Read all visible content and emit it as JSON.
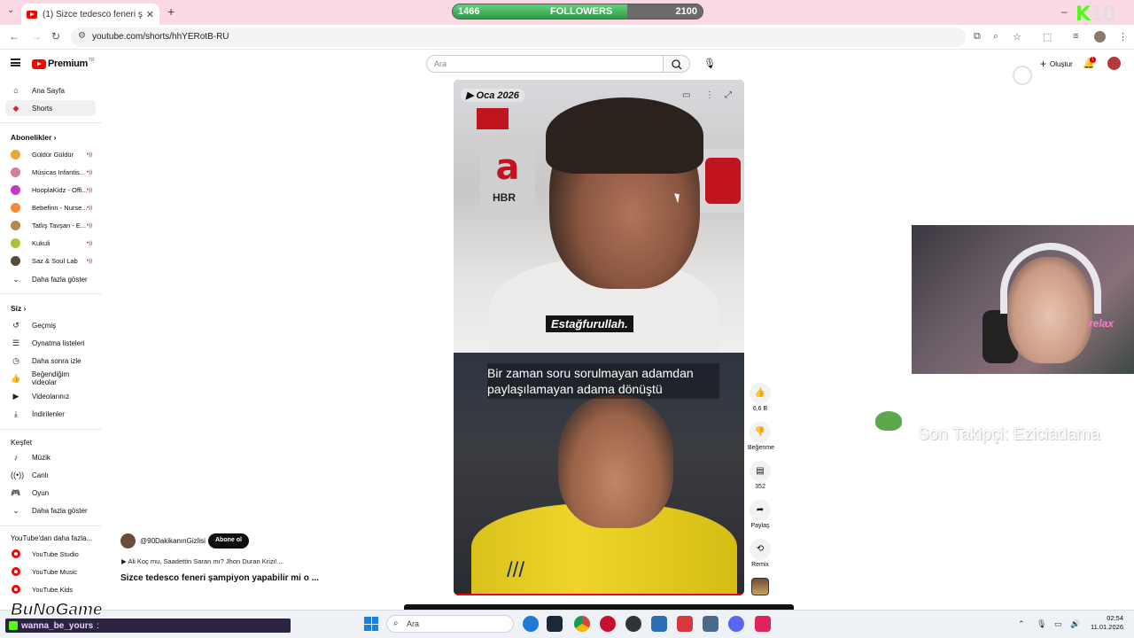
{
  "browser": {
    "tab_title": "(1) Sizce tedesco feneri şampiyon",
    "url": "youtube.com/shorts/hhYERotB-RU"
  },
  "overlay": {
    "followers_current": "1466",
    "followers_label": "FOLLOWERS",
    "followers_goal": "2100",
    "followers_progress": 0.6981,
    "kick_num": "10",
    "last_follower": "Son Takipçi: Eziciadama",
    "bunogame": "BuNoGame",
    "chat_user": "wanna_be_yours",
    "chat_sep": ":"
  },
  "header": {
    "logo": "Premium",
    "logo_cc": "TR",
    "search_placeholder": "Ara",
    "create_label": "Oluştur",
    "bell_badge": "1"
  },
  "sidebar": {
    "main": [
      {
        "label": "Ana Sayfa",
        "icon": "home-icon"
      },
      {
        "label": "Shorts",
        "icon": "shorts-icon"
      }
    ],
    "subs_title": "Abonelikler",
    "subs": [
      {
        "label": "Güldür Güldür",
        "color": "#e8a83a"
      },
      {
        "label": "Músicas Infantis...",
        "color": "#d77b9c"
      },
      {
        "label": "HooplaKidz - Offi...",
        "color": "#c23ac4"
      },
      {
        "label": "Bebefinn - Nurse...",
        "color": "#f28a3a"
      },
      {
        "label": "Tatlış Tavşan - E...",
        "color": "#b5894c"
      },
      {
        "label": "Kukuli",
        "color": "#a8c43a"
      },
      {
        "label": "Saz & Soul Lab",
        "color": "#5a4a3a"
      }
    ],
    "show_more": "Daha fazla göster",
    "you_title": "Siz",
    "you": [
      {
        "label": "Geçmiş"
      },
      {
        "label": "Oynatma listeleri"
      },
      {
        "label": "Daha sonra izle"
      },
      {
        "label": "Beğendiğim videolar"
      },
      {
        "label": "Videolarınız"
      },
      {
        "label": "İndirilenler"
      }
    ],
    "explore_title": "Keşfet",
    "explore": [
      {
        "label": "Müzik"
      },
      {
        "label": "Canlı"
      },
      {
        "label": "Oyun"
      }
    ],
    "show_more_2": "Daha fazla göster",
    "more_title": "YouTube'dan daha fazla...",
    "more": [
      {
        "label": "YouTube Studio"
      },
      {
        "label": "YouTube Music"
      },
      {
        "label": "YouTube Kids"
      }
    ]
  },
  "video": {
    "badge": "Oca 2026",
    "subtitle_top": "Estağfurullah.",
    "caption": "Bir zaman soru sorulmayan adamdan paylaşılamayan adama dönüştü",
    "backdrop_letter": "a",
    "backdrop_hbr": "HBR"
  },
  "actions": {
    "likes": "6,6 B",
    "dislike": "Beğenme",
    "comments": "352",
    "share": "Paylaş",
    "remix": "Remix"
  },
  "channel": {
    "name": "@90DakikanınGizlisi",
    "subscribe": "Abone ol",
    "music": "Ali Koç mu, Saadettin Saran mı? Jhon Duran Krizi! ...",
    "title": "Sizce tedesco feneri şampiyon yapabilir mi o ..."
  },
  "taskbar": {
    "search": "Ara",
    "time": "02:54",
    "date": "11.01.2026"
  }
}
